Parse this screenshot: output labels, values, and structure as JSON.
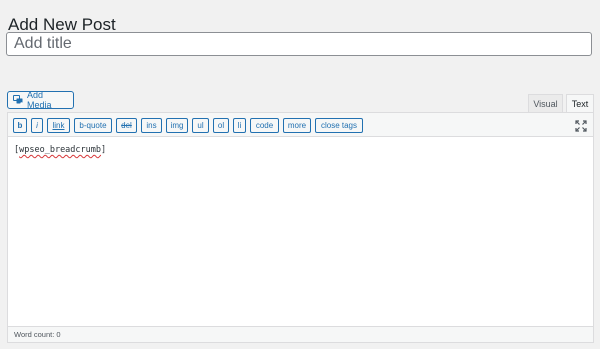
{
  "page": {
    "title": "Add New Post"
  },
  "title_field": {
    "placeholder": "Add title",
    "value": ""
  },
  "media": {
    "add_media_label": "Add Media",
    "icon": "media-icon"
  },
  "tabs": {
    "visual": "Visual",
    "text": "Text",
    "active": "Text"
  },
  "toolbar": {
    "buttons": [
      "b",
      "i",
      "link",
      "b-quote",
      "del",
      "ins",
      "img",
      "ul",
      "ol",
      "li",
      "code",
      "more",
      "close tags"
    ],
    "fullscreen_icon": "fullscreen-icon"
  },
  "editor": {
    "content_open": "[",
    "content_word": "wpseo_breadcrumb",
    "content_close": "]"
  },
  "status": {
    "word_count": "Word count: 0"
  },
  "colors": {
    "accent": "#2271b1",
    "background": "#f1f1f1",
    "spellcheck": "#d63638"
  }
}
